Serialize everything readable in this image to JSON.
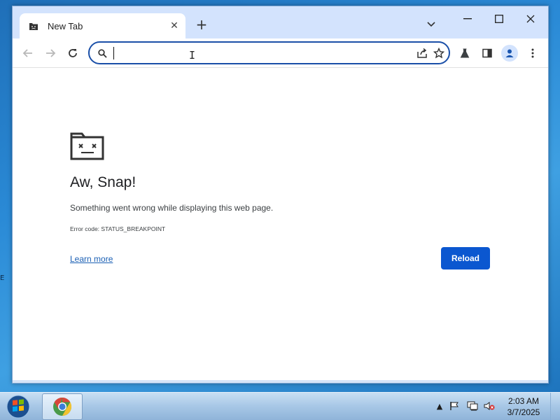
{
  "desktop": {
    "edge_glyph": "E"
  },
  "browser": {
    "tab": {
      "title": "New Tab",
      "icon": "sad-page-icon"
    },
    "new_tab_label": "+",
    "omnibox": {
      "value": "",
      "placeholder": ""
    },
    "window_controls": [
      "minimize",
      "maximize",
      "close"
    ]
  },
  "error_page": {
    "title": "Aw, Snap!",
    "message": "Something went wrong while displaying this web page.",
    "error_code": "Error code: STATUS_BREAKPOINT",
    "learn_more": "Learn more",
    "reload_label": "Reload"
  },
  "taskbar": {
    "time": "2:03 AM",
    "date": "3/7/2025"
  },
  "colors": {
    "accent": "#0b57d0",
    "link": "#1a5fb4",
    "omnibox_border": "#1a4fa8"
  }
}
